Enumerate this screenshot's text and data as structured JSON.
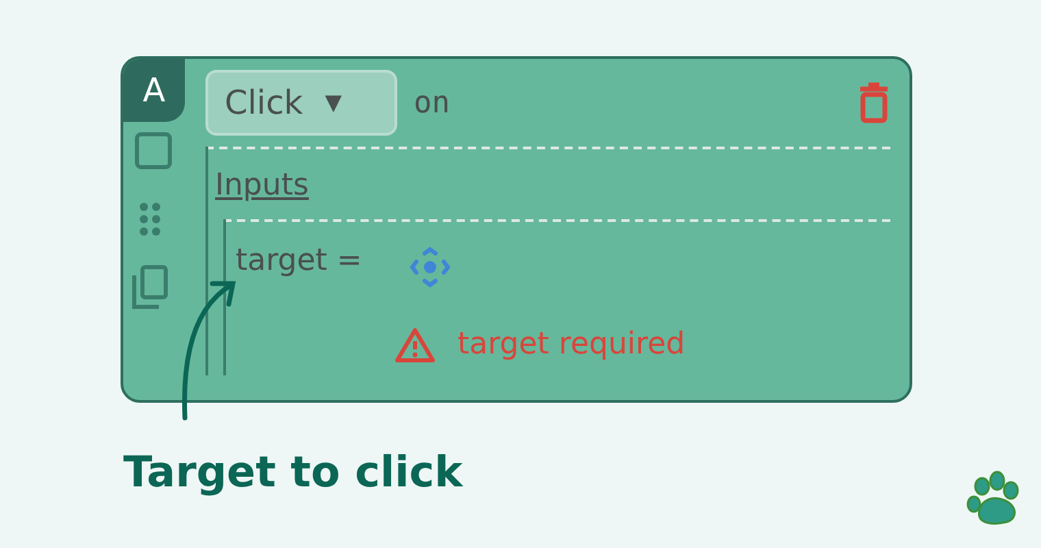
{
  "block": {
    "badge": "A",
    "action": {
      "label": "Click",
      "caret": "▼"
    },
    "connector": "on",
    "inputs": {
      "heading": "Inputs",
      "fields": [
        {
          "name": "target =",
          "error": "target required"
        }
      ]
    }
  },
  "caption": "Target to click"
}
